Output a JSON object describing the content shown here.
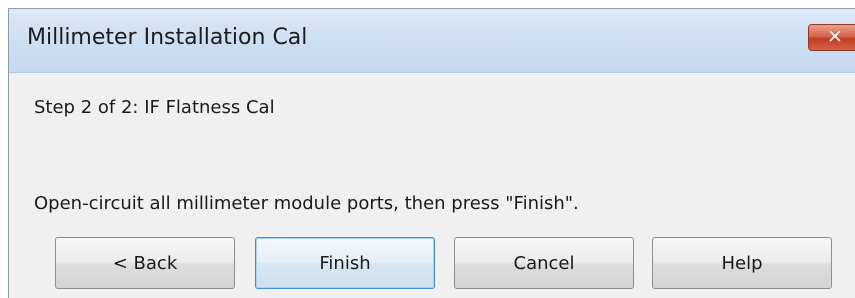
{
  "window": {
    "title": "Millimeter Installation Cal",
    "close_icon": "close-icon",
    "close_glyph": "✕"
  },
  "content": {
    "step_label": "Step 2 of 2: IF Flatness Cal",
    "instruction": "Open-circuit all millimeter module ports, then press \"Finish\"."
  },
  "buttons": {
    "back": "< Back",
    "finish": "Finish",
    "cancel": "Cancel",
    "help": "Help"
  },
  "colors": {
    "titlebar": "#cfe0f3",
    "close_button": "#c94a2e",
    "dialog_background": "#f0f0f0",
    "default_button_border": "#3c8fd8"
  }
}
